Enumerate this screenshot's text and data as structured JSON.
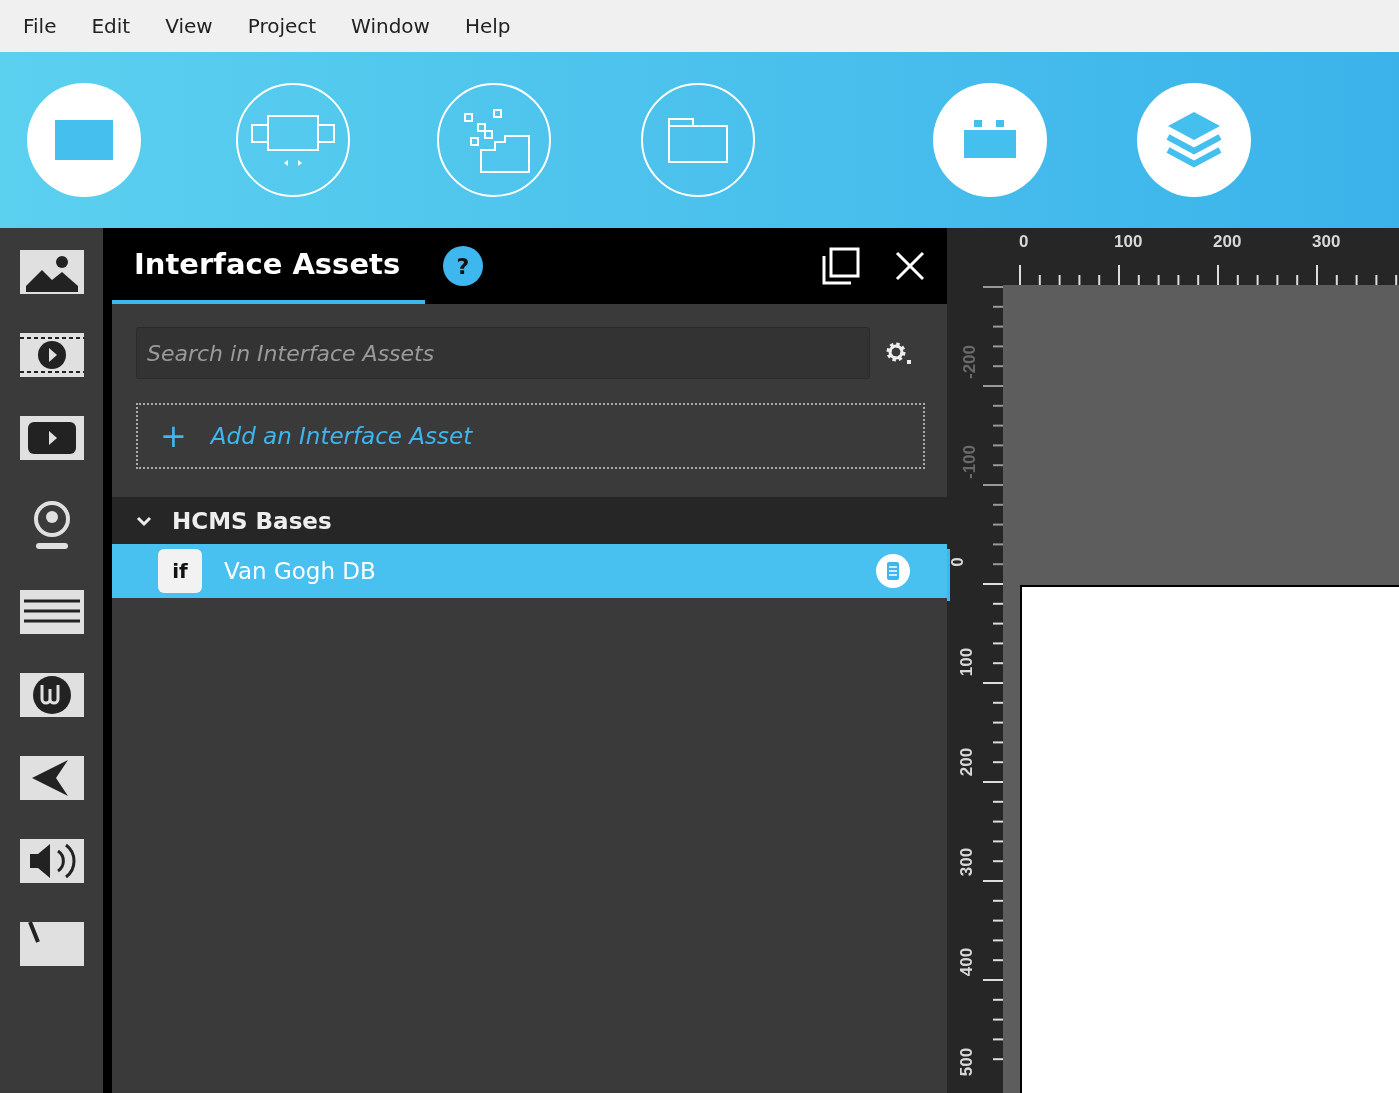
{
  "menu": [
    "File",
    "Edit",
    "View",
    "Project",
    "Window",
    "Help"
  ],
  "toolbar": [
    {
      "kind": "filled"
    },
    {
      "kind": "outline"
    },
    {
      "kind": "outline"
    },
    {
      "kind": "outline"
    },
    {
      "kind": "filled"
    },
    {
      "kind": "filled"
    }
  ],
  "panel": {
    "tabs": [
      {
        "label": "Interface Assets",
        "selected": true
      }
    ],
    "help": "?",
    "search": {
      "placeholder": "Search in Interface Assets"
    },
    "add": {
      "icon": "+",
      "label": "Add an Interface Asset"
    },
    "groups": [
      {
        "label": "HCMS Bases",
        "expanded": true,
        "items": [
          {
            "label": "Van Gogh DB",
            "logo": "if",
            "selected": true
          }
        ]
      }
    ]
  },
  "canvas": {
    "ruler_top": [
      {
        "text": "0",
        "muted": false
      },
      {
        "text": "100",
        "muted": false
      },
      {
        "text": "200",
        "muted": false
      },
      {
        "text": "300",
        "muted": false
      }
    ],
    "ruler_left": [
      {
        "text": "-200",
        "muted": true
      },
      {
        "text": "-100",
        "muted": true
      },
      {
        "text": "0",
        "muted": false
      },
      {
        "text": "100",
        "muted": false
      },
      {
        "text": "200",
        "muted": false
      },
      {
        "text": "300",
        "muted": false
      },
      {
        "text": "400",
        "muted": false
      },
      {
        "text": "500",
        "muted": false
      }
    ]
  }
}
